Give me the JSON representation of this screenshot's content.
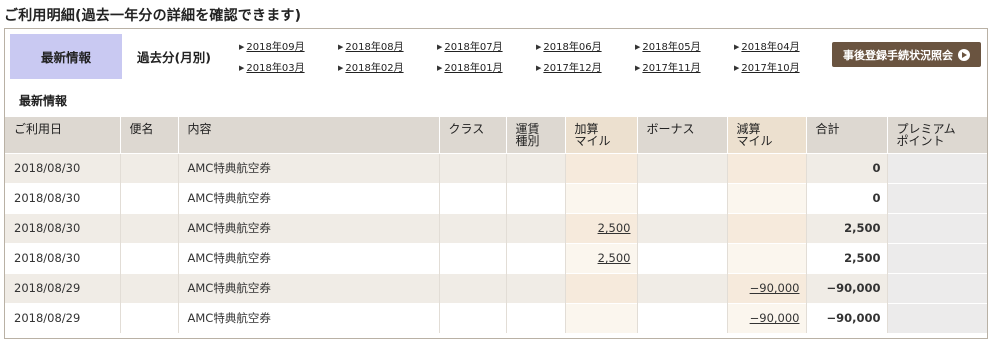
{
  "page": {
    "title": "ご利用明細(過去一年分の詳細を確認できます)"
  },
  "tabs": {
    "latest": "最新情報",
    "past_monthly": "過去分(月別)"
  },
  "months": {
    "row1": [
      "2018年09月",
      "2018年08月",
      "2018年07月",
      "2018年06月",
      "2018年05月",
      "2018年04月"
    ],
    "row2": [
      "2018年03月",
      "2018年02月",
      "2018年01月",
      "2017年12月",
      "2017年11月",
      "2017年10月"
    ]
  },
  "inquiry_button": {
    "label": "事後登録手続状況照会"
  },
  "section": {
    "label": "最新情報"
  },
  "table": {
    "headers": {
      "date": "ご利用日",
      "flight": "便名",
      "content": "内容",
      "class": "クラス",
      "fare_l1": "運賃",
      "fare_l2": "種別",
      "add_l1": "加算",
      "add_l2": "マイル",
      "bonus": "ボーナス",
      "sub_l1": "減算",
      "sub_l2": "マイル",
      "total": "合計",
      "premium_l1": "プレミアム",
      "premium_l2": "ポイント"
    },
    "rows": [
      {
        "date": "2018/08/30",
        "flight": "",
        "content": "AMC特典航空券",
        "class": "",
        "fare": "",
        "add": "",
        "bonus": "",
        "sub": "",
        "total": "0",
        "premium": ""
      },
      {
        "date": "2018/08/30",
        "flight": "",
        "content": "AMC特典航空券",
        "class": "",
        "fare": "",
        "add": "",
        "bonus": "",
        "sub": "",
        "total": "0",
        "premium": ""
      },
      {
        "date": "2018/08/30",
        "flight": "",
        "content": "AMC特典航空券",
        "class": "",
        "fare": "",
        "add": "2,500",
        "bonus": "",
        "sub": "",
        "total": "2,500",
        "premium": ""
      },
      {
        "date": "2018/08/30",
        "flight": "",
        "content": "AMC特典航空券",
        "class": "",
        "fare": "",
        "add": "2,500",
        "bonus": "",
        "sub": "",
        "total": "2,500",
        "premium": ""
      },
      {
        "date": "2018/08/29",
        "flight": "",
        "content": "AMC特典航空券",
        "class": "",
        "fare": "",
        "add": "",
        "bonus": "",
        "sub": "−90,000",
        "total": "−90,000",
        "premium": ""
      },
      {
        "date": "2018/08/29",
        "flight": "",
        "content": "AMC特典航空券",
        "class": "",
        "fare": "",
        "add": "",
        "bonus": "",
        "sub": "−90,000",
        "total": "−90,000",
        "premium": ""
      }
    ]
  }
}
